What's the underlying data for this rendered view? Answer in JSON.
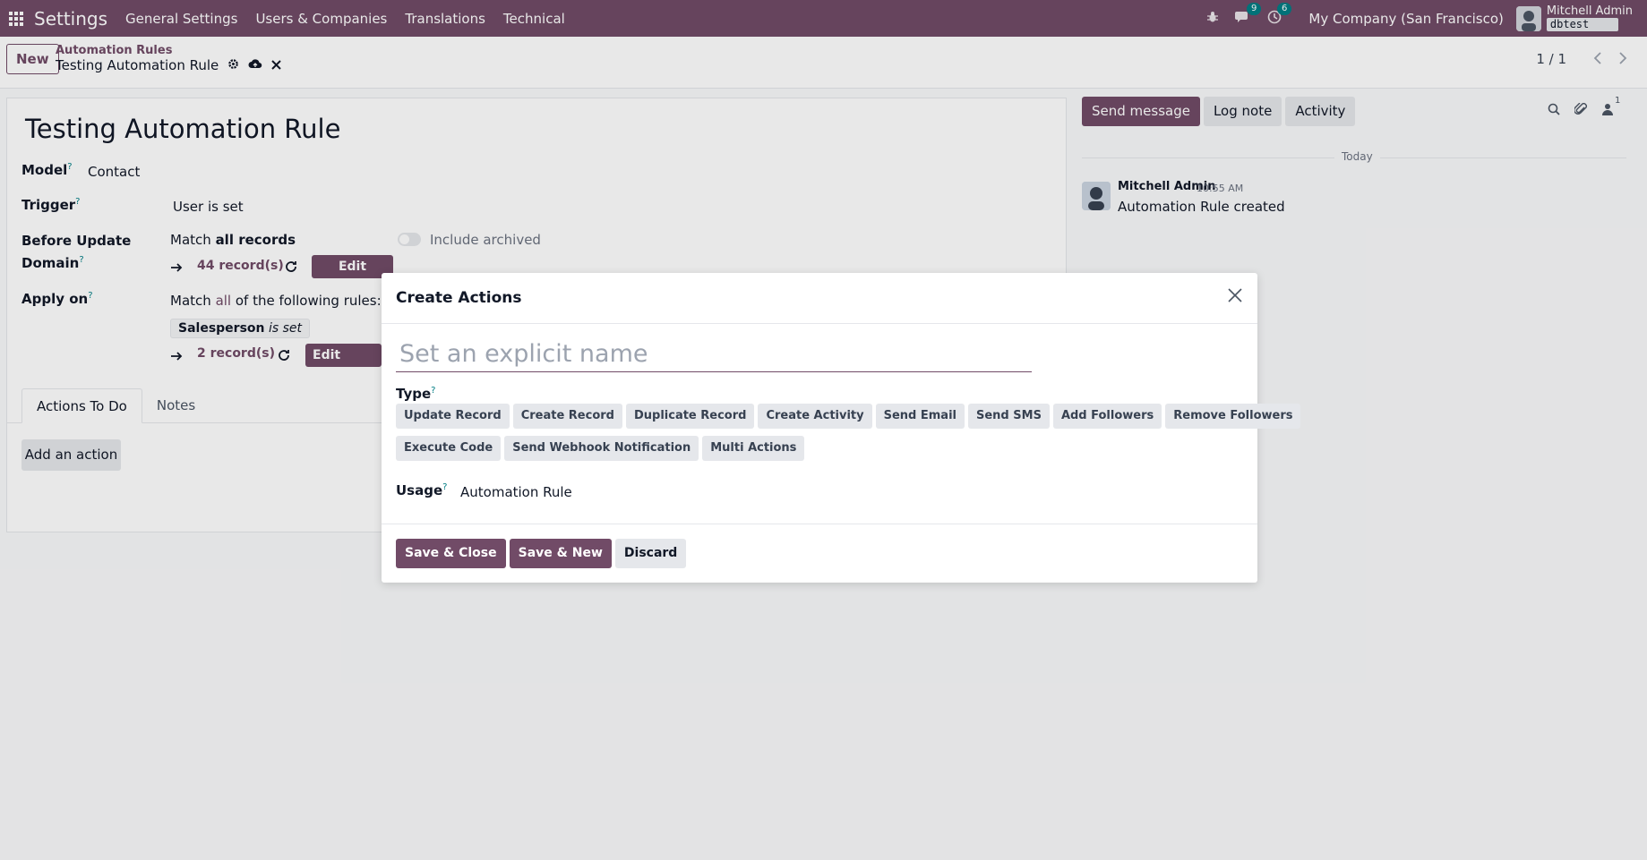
{
  "navbar": {
    "app_name": "Settings",
    "menu": [
      "General Settings",
      "Users & Companies",
      "Translations",
      "Technical"
    ],
    "messages_count": "9",
    "activities_count": "6",
    "company": "My Company (San Francisco)",
    "user_name": "Mitchell Admin",
    "database": "dbtest",
    "brand_color": "#714b67"
  },
  "control": {
    "new_label": "New",
    "breadcrumb_parent": "Automation Rules",
    "breadcrumb_current": "Testing Automation Rule",
    "pager": "1 / 1"
  },
  "form": {
    "title": "Testing Automation Rule",
    "model_label": "Model",
    "model_value": "Contact",
    "trigger_label": "Trigger",
    "trigger_value": "User is set",
    "before_update_label_1": "Before Update",
    "before_update_label_2": "Domain",
    "match_prefix": "Match",
    "match_all_records": "all records",
    "include_archived": "Include archived",
    "records_44": "44 record(s)",
    "edit_domain": "Edit Domain",
    "apply_on_label": "Apply on",
    "apply_match_prefix": "Match",
    "apply_match_all": "all",
    "apply_match_suffix": "of the following rules:",
    "rule_field": "Salesperson",
    "rule_operator": "is set",
    "records_2": "2 record(s)",
    "tabs": [
      "Actions To Do",
      "Notes"
    ],
    "add_action": "Add an action",
    "help_mark": "?"
  },
  "chatter": {
    "send_message": "Send message",
    "log_note": "Log note",
    "activity": "Activity",
    "followers_count": "1",
    "today": "Today",
    "author": "Mitchell Admin",
    "time": "10:55 AM",
    "body": "Automation Rule created"
  },
  "modal": {
    "title": "Create Actions",
    "name_placeholder": "Set an explicit name",
    "type_label": "Type",
    "types_row1": [
      "Update Record",
      "Create Record",
      "Duplicate Record",
      "Create Activity",
      "Send Email",
      "Send SMS",
      "Add Followers",
      "Remove Followers"
    ],
    "types_row2": [
      "Execute Code",
      "Send Webhook Notification",
      "Multi Actions"
    ],
    "usage_label": "Usage",
    "usage_value": "Automation Rule",
    "save_close": "Save & Close",
    "save_new": "Save & New",
    "discard": "Discard"
  }
}
